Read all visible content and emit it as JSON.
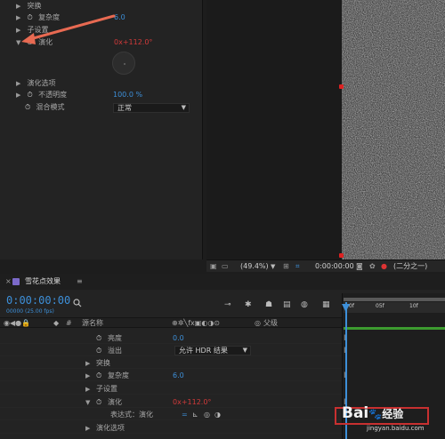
{
  "effect_controls": {
    "rows": [
      {
        "label": "突换",
        "value": ""
      },
      {
        "label": "复杂度",
        "value": "6.0"
      },
      {
        "label": "子设置",
        "value": ""
      },
      {
        "label": "演化",
        "value": "0x+112.0°"
      },
      {
        "label": "演化选项",
        "value": ""
      },
      {
        "label": "不透明度",
        "value": "100.0 %"
      },
      {
        "label": "混合模式",
        "value": "正常"
      }
    ]
  },
  "viewer_bar": {
    "zoom": "(49.4%)",
    "timecode": "0:00:00:00",
    "resolution": "(二分之一)"
  },
  "timeline": {
    "tab_title": "雪花点效果",
    "timecode": "0:00:00:00",
    "fps": "00000 (25.00 fps)",
    "col_hash": "#",
    "col_source": "源名称",
    "col_parent": "父级",
    "ruler_ticks": [
      "0f",
      "05f",
      "10f"
    ],
    "rows": [
      {
        "label": "亮度",
        "value": "0.0"
      },
      {
        "label": "溢出",
        "value": "允许 HDR 结果"
      },
      {
        "label": "突换",
        "value": ""
      },
      {
        "label": "复杂度",
        "value": "6.0"
      },
      {
        "label": "子设置",
        "value": ""
      },
      {
        "label": "演化",
        "value": "0x+112.0°"
      },
      {
        "label": "表达式：演化",
        "value": ""
      },
      {
        "label": "演化选项",
        "value": ""
      }
    ]
  },
  "watermark": {
    "logo": "Bai",
    "logo2": "经验",
    "url": "jingyan.baidu.com"
  },
  "colors": {
    "accent": "#3d8fd8",
    "value_red": "#d23a3a",
    "arrow": "#e86a52"
  }
}
